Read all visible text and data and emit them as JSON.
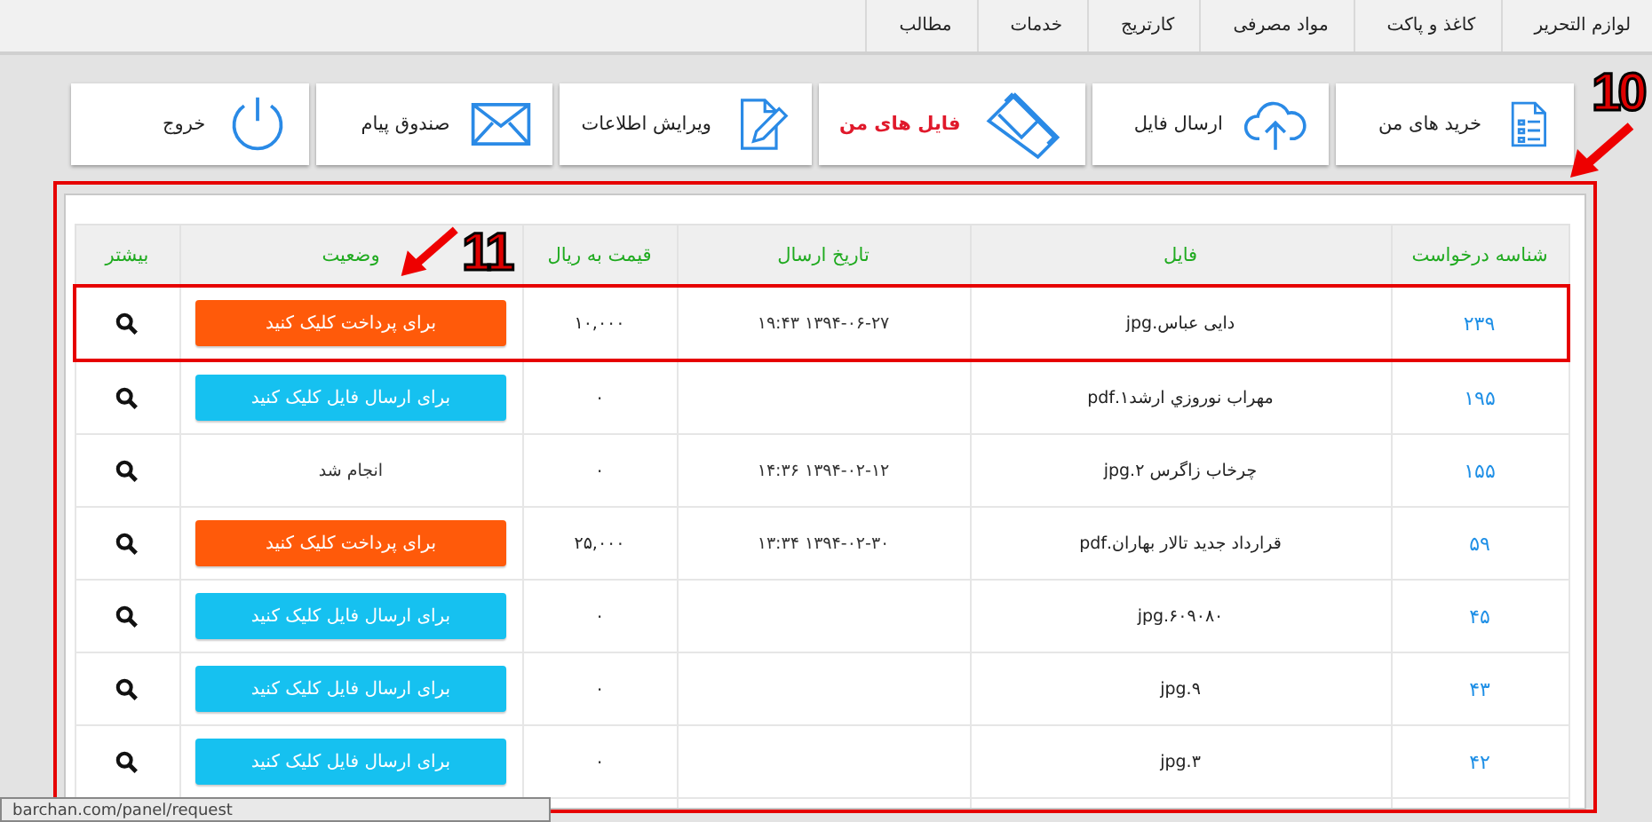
{
  "top_menu": [
    {
      "label": "لوازم التحریر"
    },
    {
      "label": "کاغذ و پاکت"
    },
    {
      "label": "مواد مصرفی"
    },
    {
      "label": "کارتریج"
    },
    {
      "label": "خدمات"
    },
    {
      "label": "مطالب"
    }
  ],
  "tiles": [
    {
      "kind": "purchases",
      "label": "خرید های من",
      "selected": false
    },
    {
      "kind": "upload",
      "label": "ارسال فایل",
      "selected": false
    },
    {
      "kind": "files",
      "label": "فایل های من",
      "selected": true
    },
    {
      "kind": "edit",
      "label": "ویرایش اطلاعات",
      "selected": false
    },
    {
      "kind": "mail",
      "label": "صندوق پیام",
      "selected": false
    },
    {
      "kind": "logout",
      "label": "خروج",
      "selected": false
    }
  ],
  "table": {
    "columns": [
      "شناسه درخواست",
      "فایل",
      "تاریخ ارسال",
      "قیمت به ریال",
      "وضعیت",
      "بیشتر"
    ],
    "rows": [
      {
        "id": "۲۳۹",
        "file": "دایی عباس.jpg",
        "date": "۱۹:۴۳ ۱۳۹۴-۰۶-۲۷",
        "price": "۱۰,۰۰۰",
        "status": {
          "kind": "pay",
          "label": "برای پرداخت کلیک کنید"
        },
        "highlighted": true
      },
      {
        "id": "۱۹۵",
        "file": "مهراب نوروزي ارشد۱.pdf",
        "date": "",
        "price": "۰",
        "status": {
          "kind": "send",
          "label": "برای ارسال فایل کلیک کنید"
        },
        "highlighted": false
      },
      {
        "id": "۱۵۵",
        "file": "چرخاب زاگرس ۲.jpg",
        "date": "۱۴:۳۶ ۱۳۹۴-۰۲-۱۲",
        "price": "۰",
        "status": {
          "kind": "done",
          "label": "انجام شد"
        },
        "highlighted": false
      },
      {
        "id": "۵۹",
        "file": "قرارداد جدید تالار بهاران.pdf",
        "date": "۱۳:۳۴ ۱۳۹۴-۰۲-۳۰",
        "price": "۲۵,۰۰۰",
        "status": {
          "kind": "pay",
          "label": "برای پرداخت کلیک کنید"
        },
        "highlighted": false
      },
      {
        "id": "۴۵",
        "file": "۶۰۹۰۸۰.jpg",
        "date": "",
        "price": "۰",
        "status": {
          "kind": "send",
          "label": "برای ارسال فایل کلیک کنید"
        },
        "highlighted": false
      },
      {
        "id": "۴۳",
        "file": "۹.jpg",
        "date": "",
        "price": "۰",
        "status": {
          "kind": "send",
          "label": "برای ارسال فایل کلیک کنید"
        },
        "highlighted": false
      },
      {
        "id": "۴۲",
        "file": "۳.jpg",
        "date": "",
        "price": "۰",
        "status": {
          "kind": "send",
          "label": "برای ارسال فایل کلیک کنید"
        },
        "highlighted": false
      }
    ]
  },
  "callouts": [
    {
      "kind": "panel",
      "label": "10"
    },
    {
      "kind": "status",
      "label": "11"
    }
  ],
  "status_url": "barchan.com/panel/request"
}
